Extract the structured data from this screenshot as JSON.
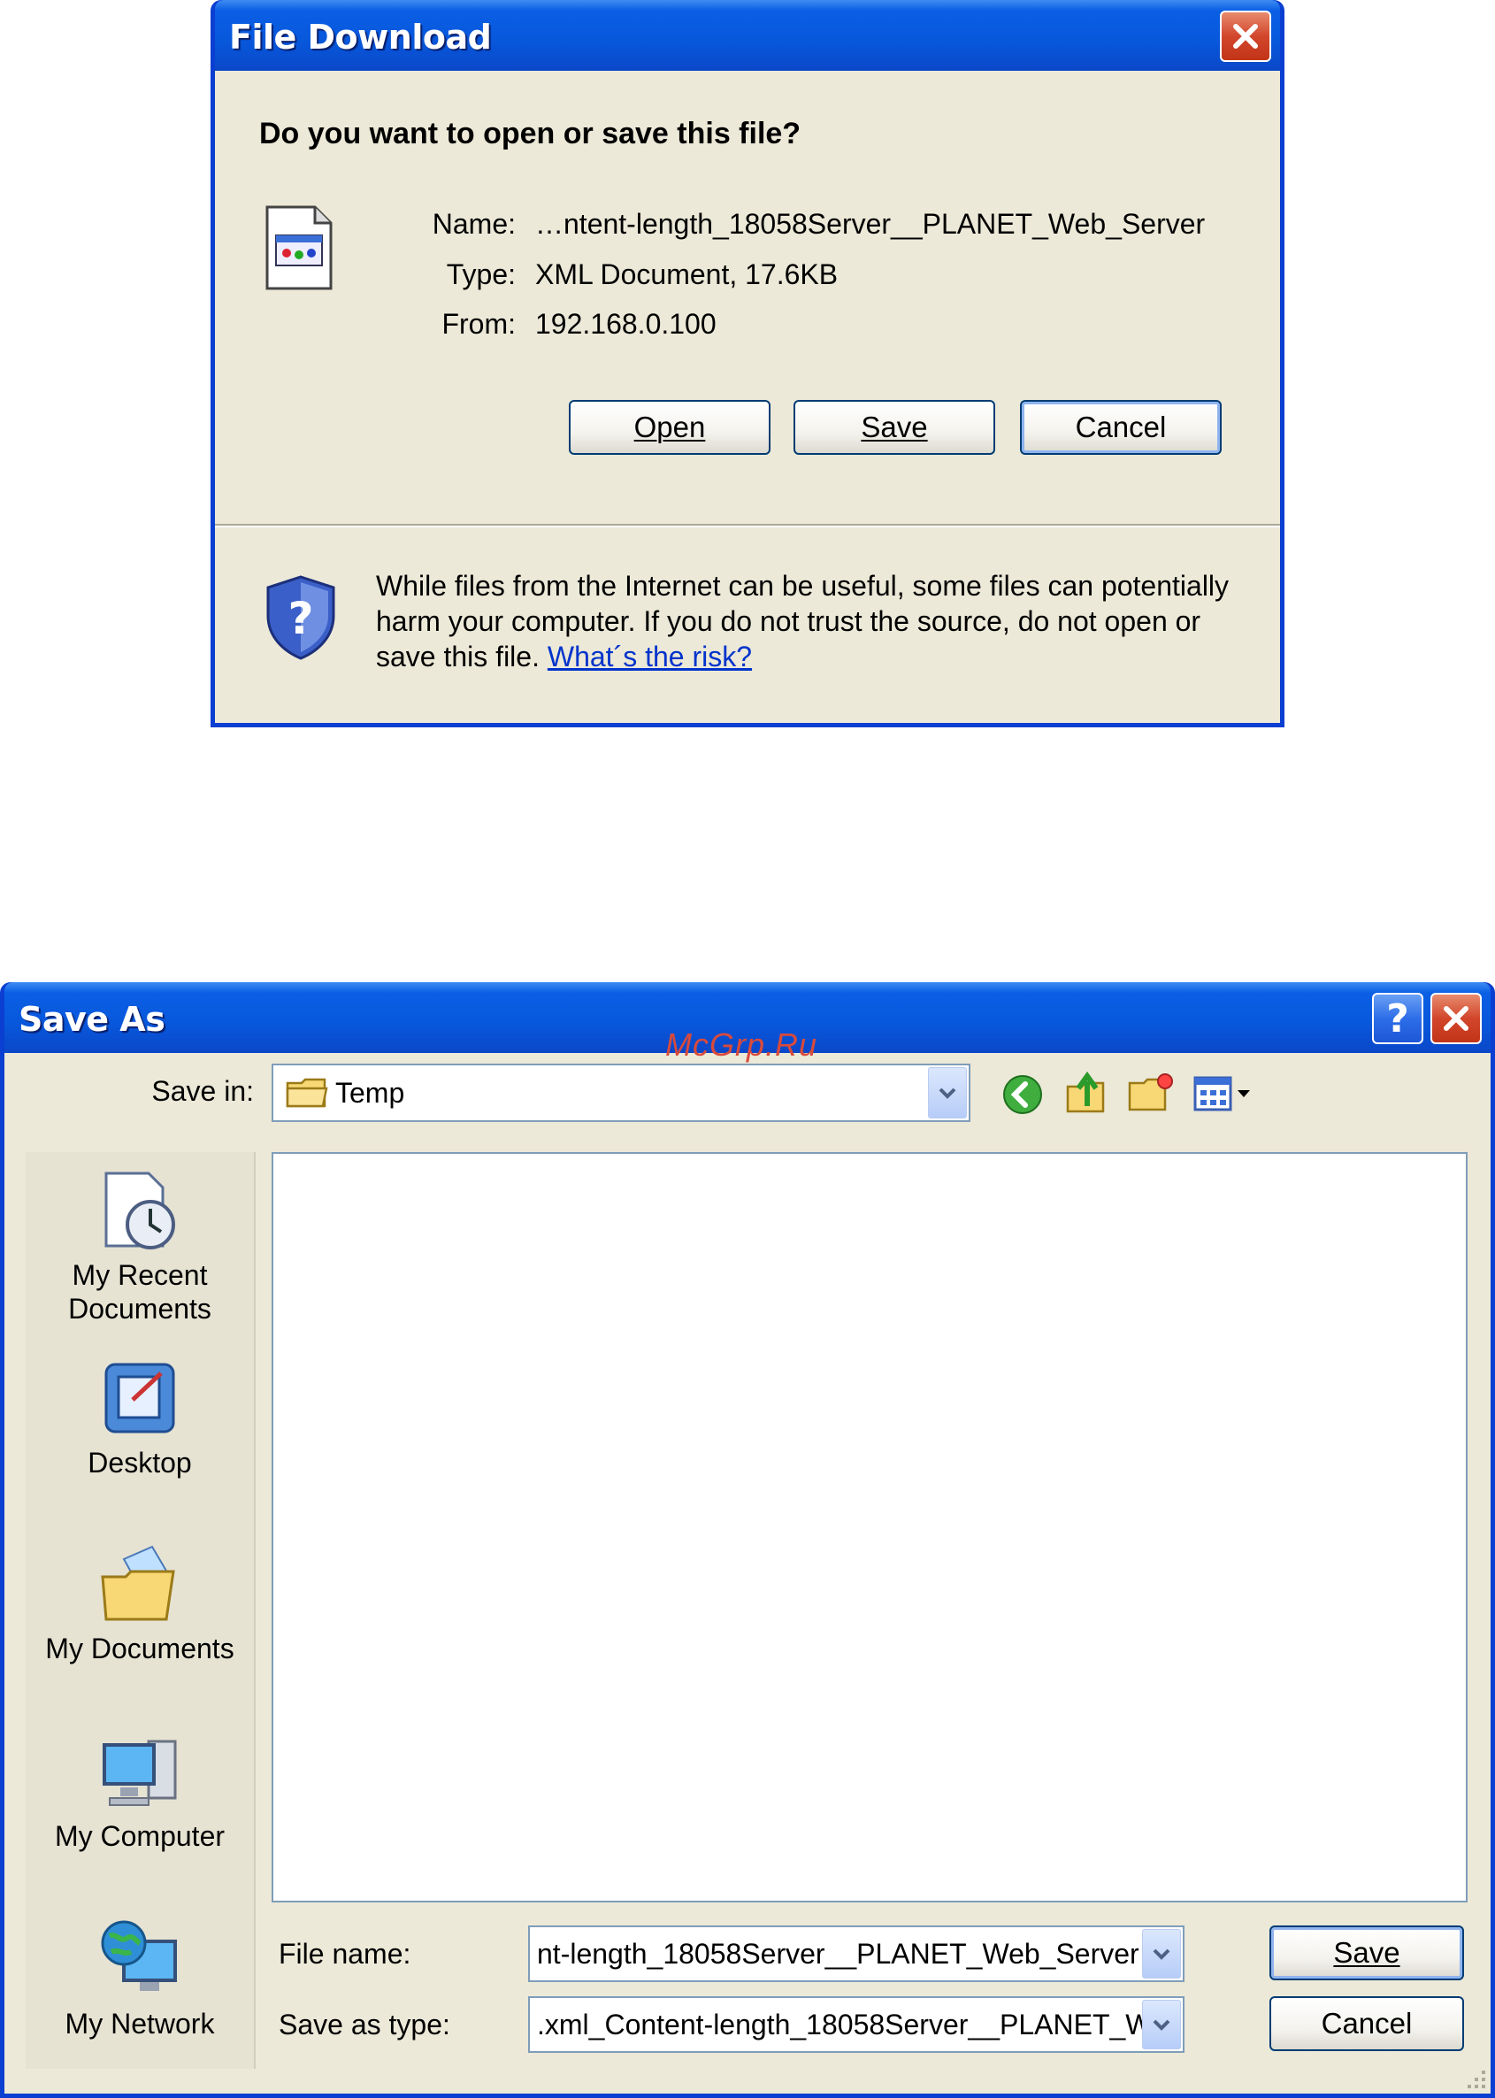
{
  "file_download": {
    "title": "File Download",
    "question": "Do you want to open or save this file?",
    "name_label": "Name:",
    "name_value": "…ntent-length_18058Server__PLANET_Web_Server",
    "type_label": "Type:",
    "type_value": "XML Document, 17.6KB",
    "from_label": "From:",
    "from_value": "192.168.0.100",
    "open_label": "Open",
    "save_label": "Save",
    "cancel_label": "Cancel",
    "warning_text": "While files from the Internet can be useful, some files can potentially harm your computer. If you do not trust the source, do not open or save this file.",
    "risk_link": "What´s the risk?"
  },
  "save_as": {
    "title": "Save As",
    "save_in_label": "Save in:",
    "save_in_value": "Temp",
    "places": [
      {
        "label": "My Recent Documents"
      },
      {
        "label": "Desktop"
      },
      {
        "label": "My Documents"
      },
      {
        "label": "My Computer"
      },
      {
        "label": "My Network"
      }
    ],
    "file_name_label": "File name:",
    "file_name_value": "nt-length_18058Server__PLANET_Web_Server",
    "save_type_label": "Save as type:",
    "save_type_value": ".xml_Content-length_18058Server__PLANET_W",
    "save_label": "Save",
    "cancel_label": "Cancel"
  },
  "watermark": "McGrp.Ru",
  "colors": {
    "titlebar": "#0a5fe4",
    "dialog_bg": "#ece9d8",
    "link": "#0033cc",
    "watermark": "#d84a3c"
  }
}
